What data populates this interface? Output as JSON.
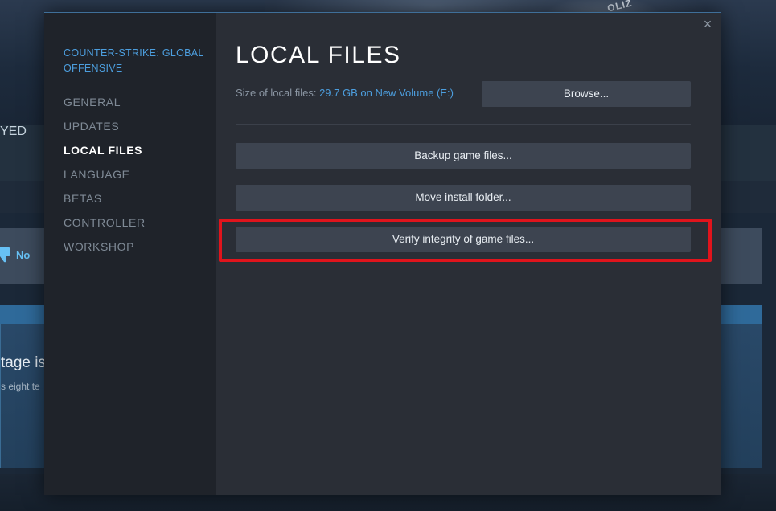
{
  "background": {
    "hero_tag": "OLIZ",
    "played_label": "YED",
    "review_no_label": "No",
    "panel_title": "tage is",
    "panel_text": "s eight te"
  },
  "dialog": {
    "game_title": "COUNTER-STRIKE: GLOBAL OFFENSIVE",
    "nav": [
      {
        "label": "GENERAL",
        "active": false
      },
      {
        "label": "UPDATES",
        "active": false
      },
      {
        "label": "LOCAL FILES",
        "active": true
      },
      {
        "label": "LANGUAGE",
        "active": false
      },
      {
        "label": "BETAS",
        "active": false
      },
      {
        "label": "CONTROLLER",
        "active": false
      },
      {
        "label": "WORKSHOP",
        "active": false
      }
    ],
    "close_glyph": "×",
    "page_title": "LOCAL FILES",
    "size_label": "Size of local files:",
    "size_value": "29.7 GB on New Volume (E:)",
    "buttons": {
      "browse": "Browse...",
      "backup": "Backup game files...",
      "move": "Move install folder...",
      "verify": "Verify integrity of game files..."
    }
  },
  "colors": {
    "accent_blue": "#4c9ede",
    "highlight_red": "#e0141c",
    "button_bg": "#3d4450"
  },
  "icons": {
    "close": "close-icon",
    "thumbs_down": "thumbs-down-icon"
  }
}
